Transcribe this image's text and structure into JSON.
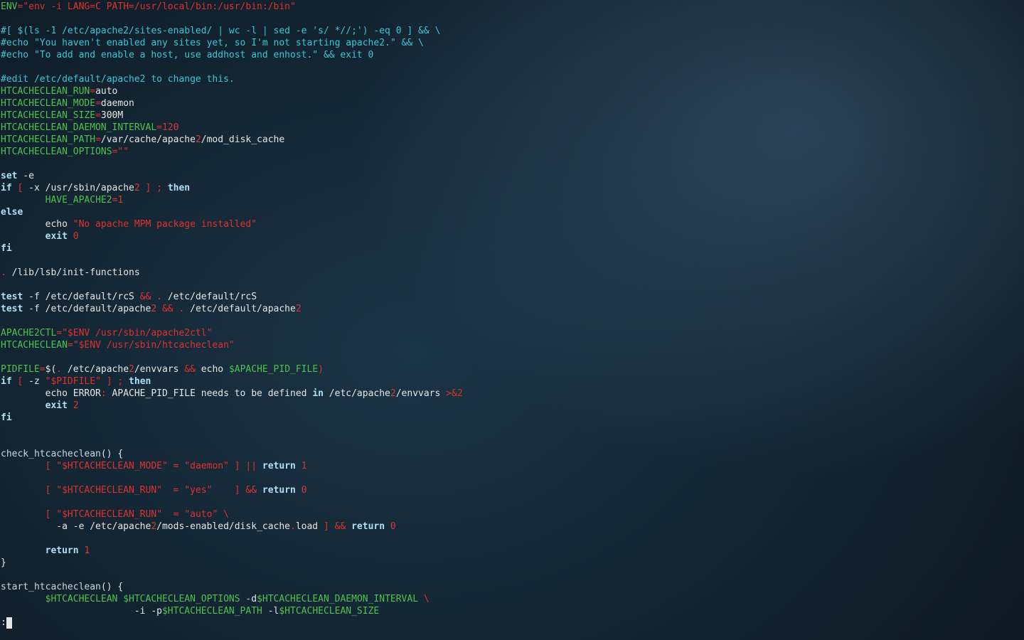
{
  "terminal": {
    "prompt": ":",
    "colors": {
      "comment": "#34c8d6",
      "variable": "#4ec24e",
      "string": "#e0302c",
      "number": "#d23a36",
      "keyword": "#aee0f5",
      "text": "#e6e6e6"
    },
    "lines": [
      [
        [
          "var",
          "ENV"
        ],
        [
          "op",
          "="
        ],
        [
          "str",
          "\"env -i LANG=C PATH=/usr/local/bin:/usr/bin:/bin\""
        ]
      ],
      [],
      [
        [
          "cmt",
          "#[ $(ls -1 /etc/apache2/sites-enabled/ | wc -l | sed -e 's/ *//;') -eq 0 ] && \\"
        ]
      ],
      [
        [
          "cmt",
          "#echo \"You haven't enabled any sites yet, so I'm not starting apache2.\" && \\"
        ]
      ],
      [
        [
          "cmt",
          "#echo \"To add and enable a host, use addhost and enhost.\" && exit 0"
        ]
      ],
      [],
      [
        [
          "cmt",
          "#edit /etc/default/apache2 to change this."
        ]
      ],
      [
        [
          "var",
          "HTCACHECLEAN_RUN"
        ],
        [
          "op",
          "="
        ],
        [
          "def",
          "auto"
        ]
      ],
      [
        [
          "var",
          "HTCACHECLEAN_MODE"
        ],
        [
          "op",
          "="
        ],
        [
          "def",
          "daemon"
        ]
      ],
      [
        [
          "var",
          "HTCACHECLEAN_SIZE"
        ],
        [
          "op",
          "="
        ],
        [
          "def",
          "300M"
        ]
      ],
      [
        [
          "var",
          "HTCACHECLEAN_DAEMON_INTERVAL"
        ],
        [
          "op",
          "="
        ],
        [
          "num",
          "120"
        ]
      ],
      [
        [
          "var",
          "HTCACHECLEAN_PATH"
        ],
        [
          "op",
          "="
        ],
        [
          "def",
          "/var/cache/apache"
        ],
        [
          "num",
          "2"
        ],
        [
          "def",
          "/mod_disk_cache"
        ]
      ],
      [
        [
          "var",
          "HTCACHECLEAN_OPTIONS"
        ],
        [
          "op",
          "="
        ],
        [
          "str",
          "\"\""
        ]
      ],
      [],
      [
        [
          "kw",
          "set"
        ],
        [
          "def",
          " -e"
        ]
      ],
      [
        [
          "kw",
          "if"
        ],
        [
          "def",
          " "
        ],
        [
          "op",
          "["
        ],
        [
          "def",
          " -x /usr/sbin/apache"
        ],
        [
          "num",
          "2"
        ],
        [
          "def",
          " "
        ],
        [
          "op",
          "]"
        ],
        [
          "def",
          " "
        ],
        [
          "op",
          ";"
        ],
        [
          "def",
          " "
        ],
        [
          "kw",
          "then"
        ]
      ],
      [
        [
          "def",
          "        "
        ],
        [
          "var",
          "HAVE_APACHE2"
        ],
        [
          "op",
          "="
        ],
        [
          "num",
          "1"
        ]
      ],
      [
        [
          "kw",
          "else"
        ]
      ],
      [
        [
          "def",
          "        echo "
        ],
        [
          "str",
          "\"No apache MPM package installed\""
        ]
      ],
      [
        [
          "def",
          "        "
        ],
        [
          "kw",
          "exit"
        ],
        [
          "def",
          " "
        ],
        [
          "num",
          "0"
        ]
      ],
      [
        [
          "kw",
          "fi"
        ]
      ],
      [],
      [
        [
          "op",
          "."
        ],
        [
          "def",
          " /lib/lsb/init-functions"
        ]
      ],
      [],
      [
        [
          "kw",
          "test"
        ],
        [
          "def",
          " -f /etc/default/rcS "
        ],
        [
          "op",
          "&&"
        ],
        [
          "def",
          " "
        ],
        [
          "op",
          "."
        ],
        [
          "def",
          " /etc/default/rcS"
        ]
      ],
      [
        [
          "kw",
          "test"
        ],
        [
          "def",
          " -f /etc/default/apache"
        ],
        [
          "num",
          "2"
        ],
        [
          "def",
          " "
        ],
        [
          "op",
          "&&"
        ],
        [
          "def",
          " "
        ],
        [
          "op",
          "."
        ],
        [
          "def",
          " /etc/default/apache"
        ],
        [
          "num",
          "2"
        ]
      ],
      [],
      [
        [
          "var",
          "APACHE2CTL"
        ],
        [
          "op",
          "="
        ],
        [
          "str",
          "\"$ENV /usr/sbin/apache2ctl\""
        ]
      ],
      [
        [
          "var",
          "HTCACHECLEAN"
        ],
        [
          "op",
          "="
        ],
        [
          "str",
          "\"$ENV /usr/sbin/htcacheclean\""
        ]
      ],
      [],
      [
        [
          "var",
          "PIDFILE"
        ],
        [
          "op",
          "="
        ],
        [
          "def",
          "$("
        ],
        [
          "op",
          "."
        ],
        [
          "def",
          " /etc/apache"
        ],
        [
          "num",
          "2"
        ],
        [
          "def",
          "/envvars "
        ],
        [
          "op",
          "&&"
        ],
        [
          "def",
          " echo "
        ],
        [
          "var",
          "$APACHE_PID_FILE"
        ],
        [
          "op",
          ")"
        ]
      ],
      [
        [
          "kw",
          "if"
        ],
        [
          "def",
          " "
        ],
        [
          "op",
          "["
        ],
        [
          "def",
          " -z "
        ],
        [
          "str",
          "\"$PIDFILE\""
        ],
        [
          "def",
          " "
        ],
        [
          "op",
          "]"
        ],
        [
          "def",
          " "
        ],
        [
          "op",
          ";"
        ],
        [
          "def",
          " "
        ],
        [
          "kw",
          "then"
        ]
      ],
      [
        [
          "def",
          "        echo ERROR"
        ],
        [
          "op",
          ":"
        ],
        [
          "def",
          " APACHE_PID_FILE needs to be defined "
        ],
        [
          "kw",
          "in"
        ],
        [
          "def",
          " /etc/apache"
        ],
        [
          "num",
          "2"
        ],
        [
          "def",
          "/envvars "
        ],
        [
          "op",
          ">&2"
        ]
      ],
      [
        [
          "def",
          "        "
        ],
        [
          "kw",
          "exit"
        ],
        [
          "def",
          " "
        ],
        [
          "num",
          "2"
        ]
      ],
      [
        [
          "kw",
          "fi"
        ]
      ],
      [],
      [],
      [
        [
          "fn",
          "check_htcacheclean"
        ],
        [
          "def",
          "() {"
        ]
      ],
      [
        [
          "def",
          "        "
        ],
        [
          "op",
          "["
        ],
        [
          "def",
          " "
        ],
        [
          "str",
          "\"$HTCACHECLEAN_MODE\""
        ],
        [
          "def",
          " "
        ],
        [
          "op",
          "="
        ],
        [
          "def",
          " "
        ],
        [
          "str",
          "\"daemon\""
        ],
        [
          "def",
          " "
        ],
        [
          "op",
          "]"
        ],
        [
          "def",
          " "
        ],
        [
          "op",
          "||"
        ],
        [
          "def",
          " "
        ],
        [
          "kw",
          "return"
        ],
        [
          "def",
          " "
        ],
        [
          "num",
          "1"
        ]
      ],
      [],
      [
        [
          "def",
          "        "
        ],
        [
          "op",
          "["
        ],
        [
          "def",
          " "
        ],
        [
          "str",
          "\"$HTCACHECLEAN_RUN\""
        ],
        [
          "def",
          "  "
        ],
        [
          "op",
          "="
        ],
        [
          "def",
          " "
        ],
        [
          "str",
          "\"yes\""
        ],
        [
          "def",
          "    "
        ],
        [
          "op",
          "]"
        ],
        [
          "def",
          " "
        ],
        [
          "op",
          "&&"
        ],
        [
          "def",
          " "
        ],
        [
          "kw",
          "return"
        ],
        [
          "def",
          " "
        ],
        [
          "num",
          "0"
        ]
      ],
      [],
      [
        [
          "def",
          "        "
        ],
        [
          "op",
          "["
        ],
        [
          "def",
          " "
        ],
        [
          "str",
          "\"$HTCACHECLEAN_RUN\""
        ],
        [
          "def",
          "  "
        ],
        [
          "op",
          "="
        ],
        [
          "def",
          " "
        ],
        [
          "str",
          "\"auto\""
        ],
        [
          "def",
          " "
        ],
        [
          "op",
          "\\"
        ]
      ],
      [
        [
          "def",
          "          -a -e /etc/apache"
        ],
        [
          "num",
          "2"
        ],
        [
          "def",
          "/mods-enabled/disk_cache"
        ],
        [
          "op",
          "."
        ],
        [
          "def",
          "load "
        ],
        [
          "op",
          "]"
        ],
        [
          "def",
          " "
        ],
        [
          "op",
          "&&"
        ],
        [
          "def",
          " "
        ],
        [
          "kw",
          "return"
        ],
        [
          "def",
          " "
        ],
        [
          "num",
          "0"
        ]
      ],
      [],
      [
        [
          "def",
          "        "
        ],
        [
          "kw",
          "return"
        ],
        [
          "def",
          " "
        ],
        [
          "num",
          "1"
        ]
      ],
      [
        [
          "def",
          "}"
        ]
      ],
      [],
      [
        [
          "fn",
          "start_htcacheclean"
        ],
        [
          "def",
          "() {"
        ]
      ],
      [
        [
          "def",
          "        "
        ],
        [
          "var",
          "$HTCACHECLEAN"
        ],
        [
          "def",
          " "
        ],
        [
          "var",
          "$HTCACHECLEAN_OPTIONS"
        ],
        [
          "def",
          " -d"
        ],
        [
          "var",
          "$HTCACHECLEAN_DAEMON_INTERVAL"
        ],
        [
          "def",
          " "
        ],
        [
          "op",
          "\\"
        ]
      ],
      [
        [
          "def",
          "                        -i -p"
        ],
        [
          "var",
          "$HTCACHECLEAN_PATH"
        ],
        [
          "def",
          " -l"
        ],
        [
          "var",
          "$HTCACHECLEAN_SIZE"
        ]
      ]
    ]
  }
}
